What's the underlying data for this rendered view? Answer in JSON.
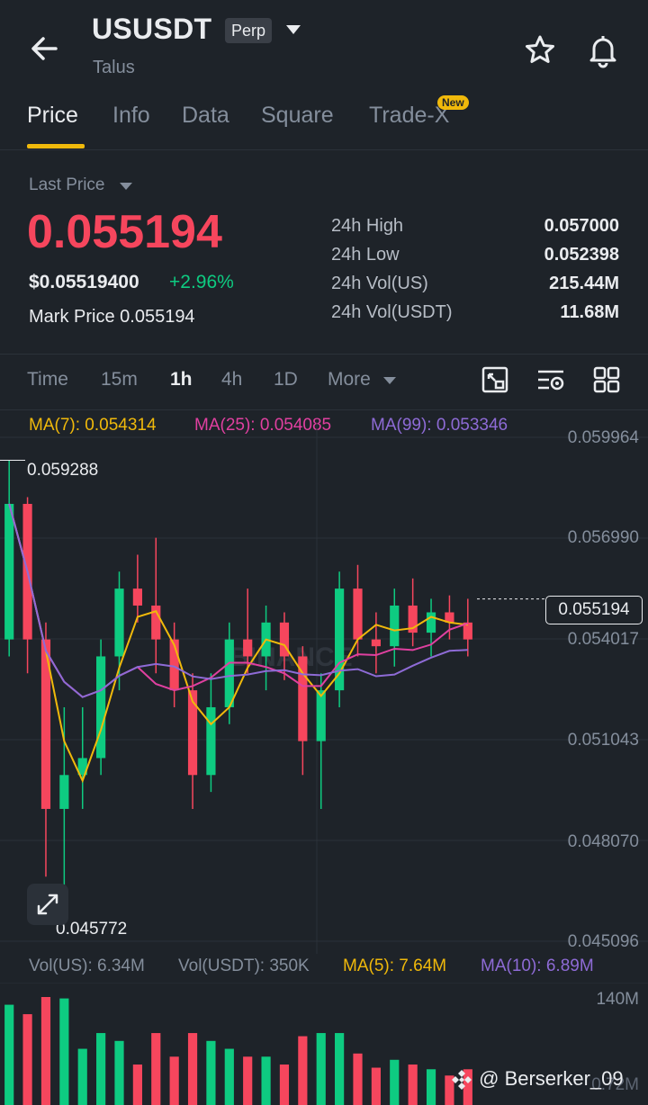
{
  "header": {
    "symbol": "USUSDT",
    "contract_badge": "Perp",
    "subtitle": "Talus",
    "icons": [
      "back-arrow-icon",
      "chevron-down-icon",
      "star-icon",
      "bell-icon"
    ]
  },
  "tabs": [
    {
      "label": "Price",
      "active": true
    },
    {
      "label": "Info"
    },
    {
      "label": "Data"
    },
    {
      "label": "Square"
    },
    {
      "label": "Trade-X",
      "badge": "New"
    }
  ],
  "ticker": {
    "last_price_label": "Last Price",
    "last_price": "0.055194",
    "usd_price": "$0.05519400",
    "change": "+2.96%",
    "mark_price_label": "Mark Price",
    "mark_price": "0.055194",
    "stats": [
      {
        "label": "24h High",
        "value": "0.057000"
      },
      {
        "label": "24h Low",
        "value": "0.052398"
      },
      {
        "label": "24h Vol(US)",
        "value": "215.44M"
      },
      {
        "label": "24h Vol(USDT)",
        "value": "11.68M"
      }
    ]
  },
  "timeframes": [
    {
      "label": "Time"
    },
    {
      "label": "15m"
    },
    {
      "label": "1h",
      "active": true
    },
    {
      "label": "4h"
    },
    {
      "label": "1D"
    },
    {
      "label": "More"
    }
  ],
  "chart_tools": [
    "chart-expand-icon",
    "indicator-settings-icon",
    "grid-layout-icon"
  ],
  "indicators": {
    "ma7": "MA(7): 0.054314",
    "ma25": "MA(25): 0.054085",
    "ma99": "MA(99): 0.053346"
  },
  "colors": {
    "up": "#0ecb81",
    "down": "#f6465d",
    "ma7": "#f0b90b",
    "ma25": "#e040a0",
    "ma99": "#8e6bd6",
    "accent": "#f0b90b"
  },
  "price_axis": [
    "0.059964",
    "0.056990",
    "0.054017",
    "0.051043",
    "0.048070",
    "0.045096"
  ],
  "current_price_tag": "0.055194",
  "high_marker": "0.059288",
  "low_marker": "0.045772",
  "watermark_logo": "BINANCE",
  "volume": {
    "vol_us": "Vol(US): 6.34M",
    "vol_usdt": "Vol(USDT): 350K",
    "ma5": "MA(5): 7.64M",
    "ma10": "MA(10): 6.89M",
    "axis_top": "140M",
    "axis_bottom": "0.72M"
  },
  "footer": {
    "credit": "@ Berserker_09"
  },
  "chart_data": {
    "type": "candlestick",
    "interval": "1h",
    "ylim": [
      0.045096,
      0.059964
    ],
    "ohlc": [
      [
        0.054,
        0.0593,
        0.0535,
        0.058
      ],
      [
        0.058,
        0.0582,
        0.053,
        0.054
      ],
      [
        0.054,
        0.0545,
        0.047,
        0.049
      ],
      [
        0.049,
        0.052,
        0.0458,
        0.05
      ],
      [
        0.05,
        0.052,
        0.049,
        0.0505
      ],
      [
        0.0505,
        0.054,
        0.05,
        0.0535
      ],
      [
        0.0535,
        0.056,
        0.0525,
        0.0555
      ],
      [
        0.0555,
        0.0565,
        0.0545,
        0.055
      ],
      [
        0.055,
        0.057,
        0.053,
        0.054
      ],
      [
        0.054,
        0.0545,
        0.052,
        0.0525
      ],
      [
        0.0525,
        0.053,
        0.049,
        0.05
      ],
      [
        0.05,
        0.053,
        0.0495,
        0.052
      ],
      [
        0.052,
        0.0545,
        0.0515,
        0.054
      ],
      [
        0.054,
        0.0555,
        0.053,
        0.0535
      ],
      [
        0.0535,
        0.055,
        0.0525,
        0.0545
      ],
      [
        0.0545,
        0.0548,
        0.0528,
        0.0535
      ],
      [
        0.0535,
        0.0538,
        0.05,
        0.051
      ],
      [
        0.051,
        0.053,
        0.049,
        0.0525
      ],
      [
        0.0525,
        0.056,
        0.052,
        0.0555
      ],
      [
        0.0555,
        0.0562,
        0.0535,
        0.054
      ],
      [
        0.054,
        0.0548,
        0.053,
        0.0538
      ],
      [
        0.0538,
        0.0555,
        0.0532,
        0.055
      ],
      [
        0.055,
        0.0558,
        0.0538,
        0.0542
      ],
      [
        0.0542,
        0.0552,
        0.0535,
        0.0548
      ],
      [
        0.0548,
        0.0553,
        0.054,
        0.0545
      ],
      [
        0.0545,
        0.0552,
        0.0535,
        0.054
      ]
    ],
    "ma": [
      {
        "name": "MA(7)",
        "value": 0.054314
      },
      {
        "name": "MA(25)",
        "value": 0.054085
      },
      {
        "name": "MA(99)",
        "value": 0.053346
      }
    ]
  }
}
